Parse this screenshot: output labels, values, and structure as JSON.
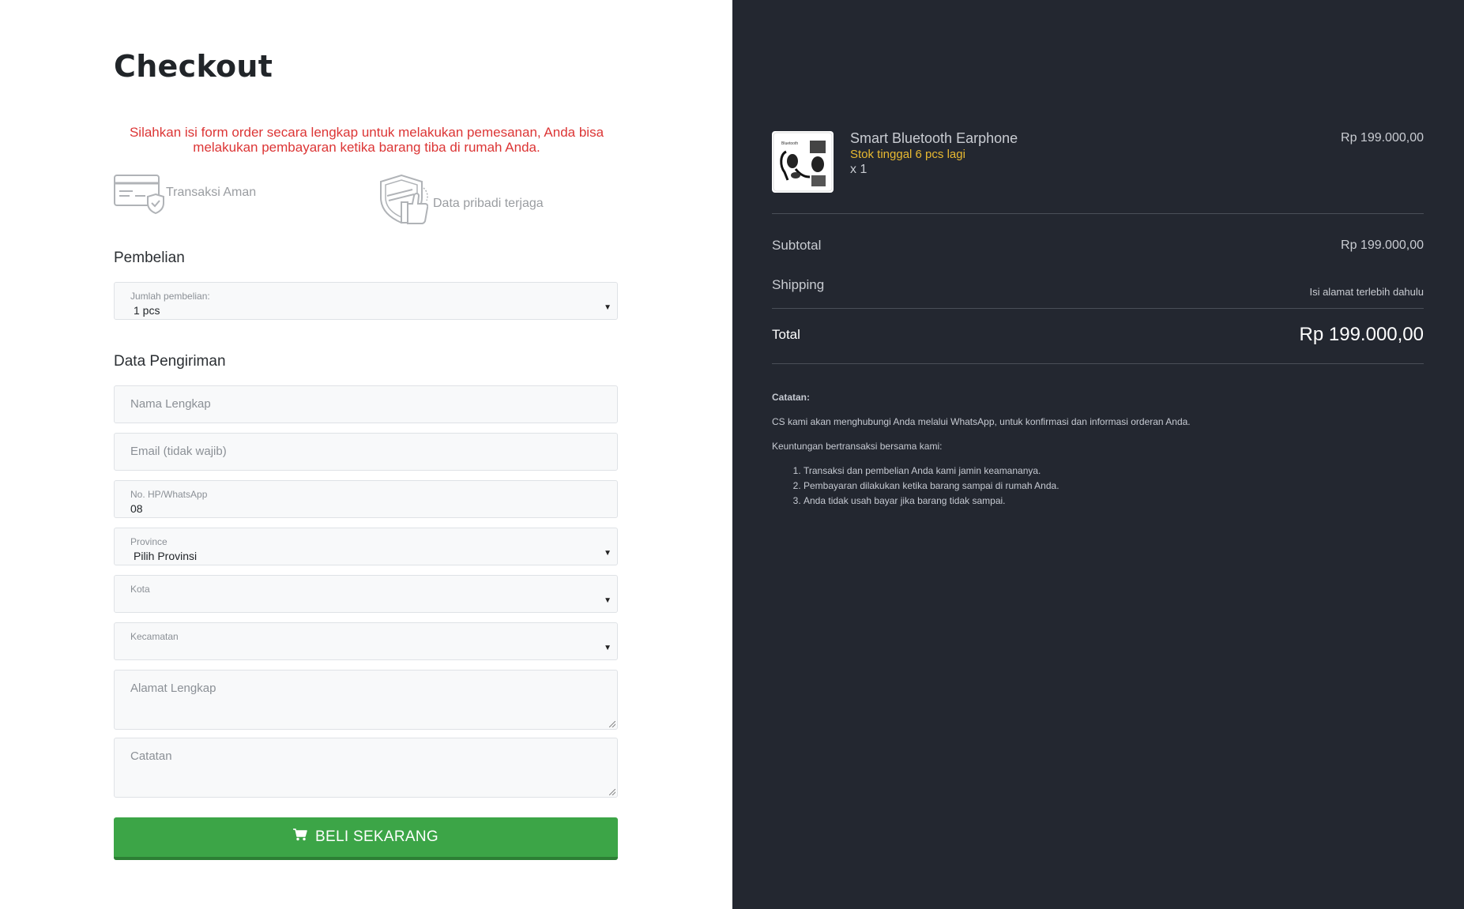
{
  "page": {
    "title": "Checkout",
    "notice": "Silahkan isi form order secara lengkap untuk melakukan pemesanan, Anda bisa melakukan pembayaran ketika barang tiba di rumah Anda."
  },
  "badges": [
    {
      "label": "Transaksi Aman",
      "icon": "secure-card-icon"
    },
    {
      "label": "Data pribadi terjaga",
      "icon": "shield-thumbs-up-icon"
    }
  ],
  "purchase": {
    "section_title": "Pembelian",
    "qty_label": "Jumlah pembelian:",
    "qty_value": "1 pcs"
  },
  "shipping": {
    "section_title": "Data Pengiriman",
    "name_placeholder": "Nama Lengkap",
    "email_placeholder": "Email (tidak wajib)",
    "phone_label": "No. HP/WhatsApp",
    "phone_value": "08",
    "province_label": "Province",
    "province_value": "Pilih Provinsi",
    "city_label": "Kota",
    "district_label": "Kecamatan",
    "address_placeholder": "Alamat Lengkap",
    "notes_placeholder": "Catatan"
  },
  "buy_button": {
    "label": "BELI SEKARANG",
    "icon": "cart-icon",
    "color": "#3ca547"
  },
  "order": {
    "product_name": "Smart Bluetooth Earphone",
    "stock_text": "Stok tinggal 6 pcs lagi",
    "qty_text": "x 1",
    "price": "Rp 199.000,00",
    "subtotal_label": "Subtotal",
    "subtotal_value": "Rp 199.000,00",
    "shipping_label": "Shipping",
    "shipping_value": "Isi alamat terlebih dahulu",
    "total_label": "Total",
    "total_value": "Rp 199.000,00"
  },
  "notes": {
    "heading": "Catatan:",
    "line1": "CS kami akan menghubungi Anda melalui WhatsApp, untuk konfirmasi dan informasi orderan Anda.",
    "line2": "Keuntungan bertransaksi bersama kami:",
    "items": [
      "Transaksi dan pembelian Anda kami jamin keamananya.",
      "Pembayaran dilakukan ketika barang sampai di rumah Anda.",
      "Anda tidak usah bayar jika barang tidak sampai."
    ]
  },
  "colors": {
    "left_bg": "#ffffff",
    "right_bg": "#232730",
    "notice": "#dc3535",
    "stock": "#e8b931",
    "button": "#3ca547"
  }
}
